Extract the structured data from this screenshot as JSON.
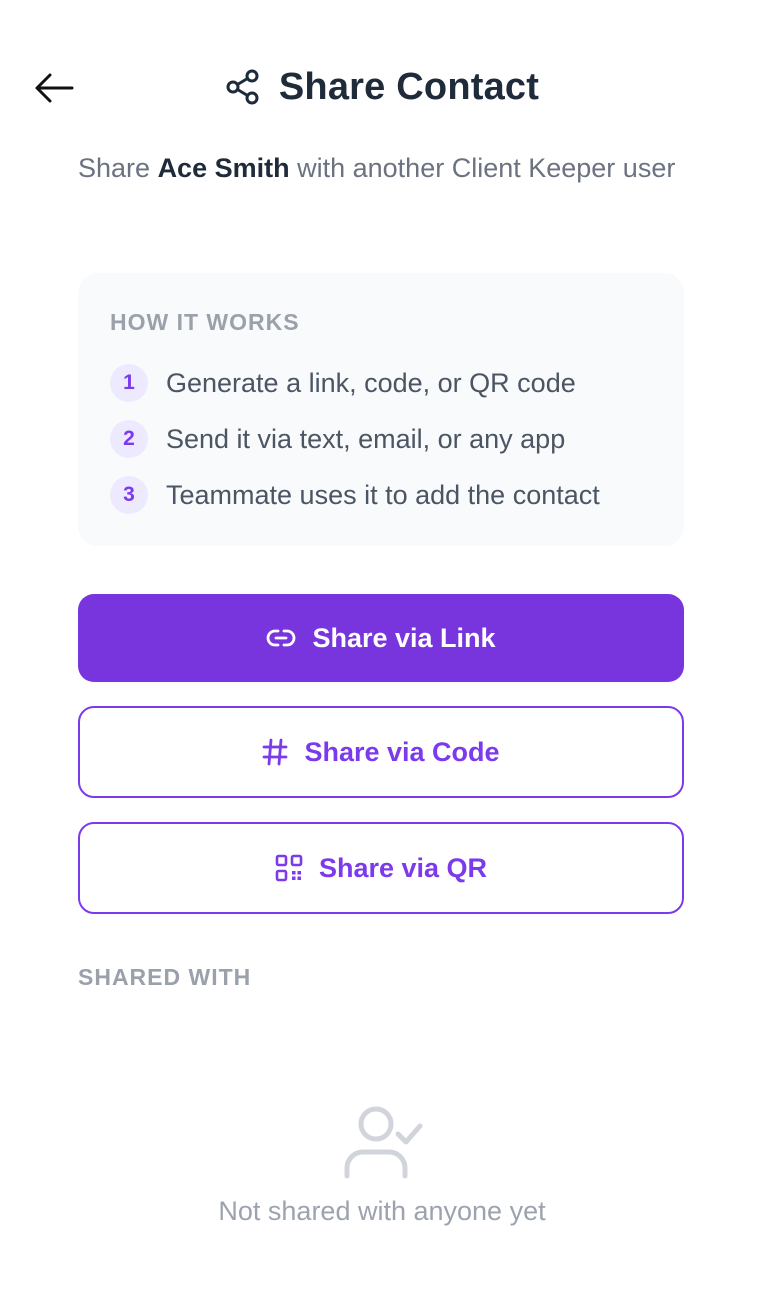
{
  "header": {
    "back_icon": "arrow-left-icon",
    "title_icon": "share-icon",
    "title": "Share Contact"
  },
  "subtitle": {
    "prefix": "Share ",
    "contact_name": "Ace Smith",
    "suffix": " with another Client Keeper user"
  },
  "how_it_works": {
    "title": "HOW IT WORKS",
    "steps": [
      {
        "number": "1",
        "text": "Generate a link, code, or QR code"
      },
      {
        "number": "2",
        "text": "Send it via text, email, or any app"
      },
      {
        "number": "3",
        "text": "Teammate uses it to add the contact"
      }
    ]
  },
  "actions": {
    "link": {
      "label": "Share via Link",
      "icon": "link-icon"
    },
    "code": {
      "label": "Share via Code",
      "icon": "hash-icon"
    },
    "qr": {
      "label": "Share via QR",
      "icon": "qr-code-icon"
    }
  },
  "shared_with": {
    "title": "SHARED WITH",
    "empty_icon": "user-check-icon",
    "empty_text": "Not shared with anyone yet"
  },
  "colors": {
    "accent": "#7935dd",
    "accent_light": "#ede9fe",
    "muted_text": "#9aa1ab",
    "card_bg": "#f8fafc"
  }
}
